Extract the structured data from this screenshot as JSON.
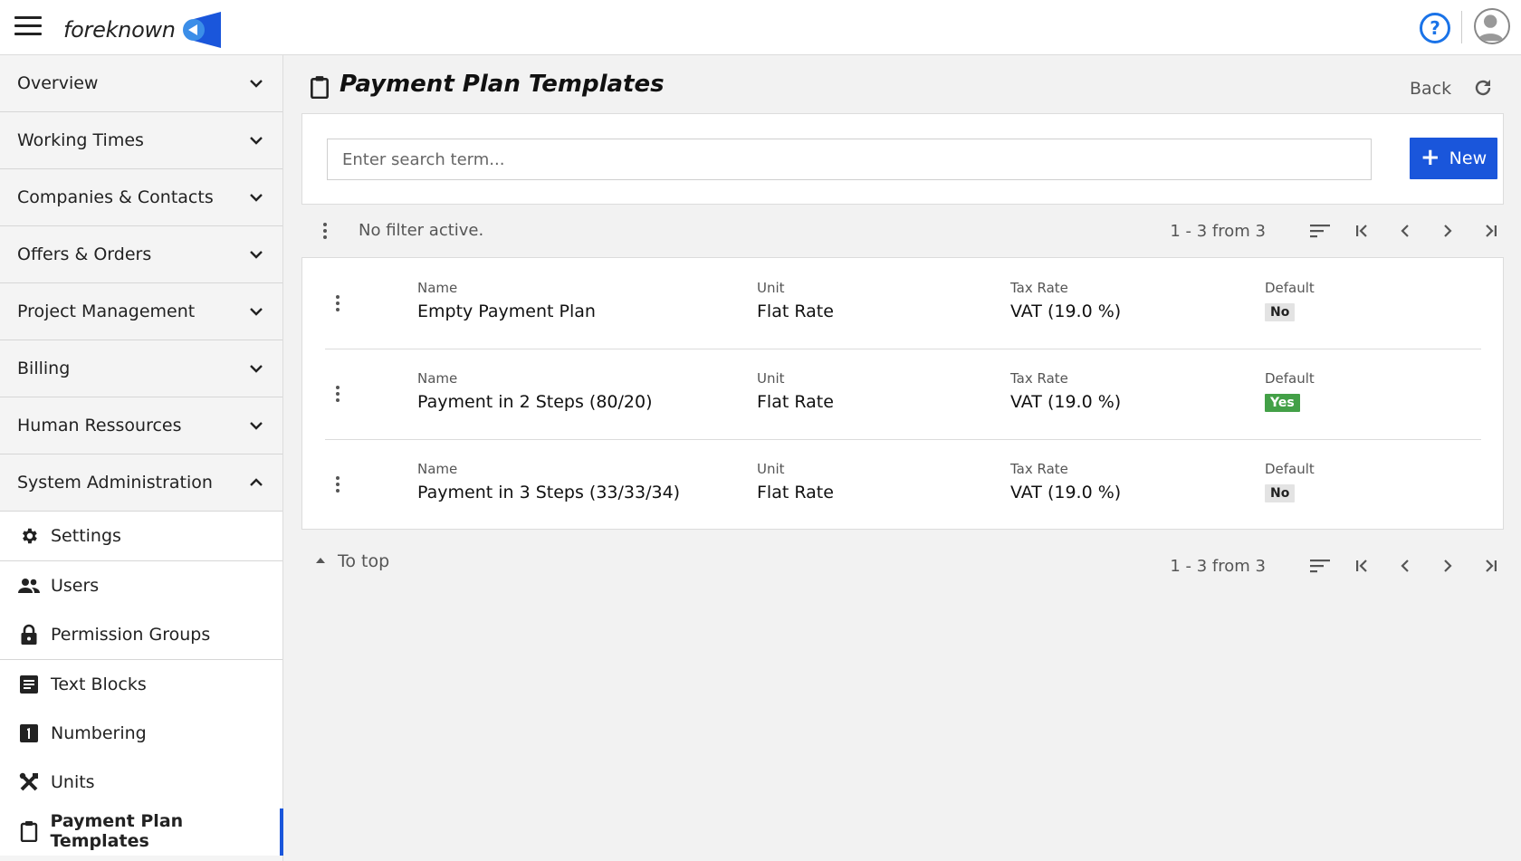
{
  "header": {
    "brand_name": "foreknown",
    "help_symbol": "?",
    "menu_icon": "hamburger-icon",
    "avatar_icon": "user-avatar-icon"
  },
  "sidebar": {
    "sections": [
      {
        "label": "Overview",
        "expanded": false
      },
      {
        "label": "Working Times",
        "expanded": false
      },
      {
        "label": "Companies & Contacts",
        "expanded": false
      },
      {
        "label": "Offers & Orders",
        "expanded": false
      },
      {
        "label": "Project Management",
        "expanded": false
      },
      {
        "label": "Billing",
        "expanded": false
      },
      {
        "label": "Human Ressources",
        "expanded": false
      },
      {
        "label": "System Administration",
        "expanded": true
      }
    ],
    "subitems": [
      {
        "label": "Settings",
        "icon": "gear-icon"
      },
      {
        "label": "Users",
        "icon": "users-icon"
      },
      {
        "label": "Permission Groups",
        "icon": "lock-icon"
      },
      {
        "label": "Text Blocks",
        "icon": "text-block-icon"
      },
      {
        "label": "Numbering",
        "icon": "numbering-icon"
      },
      {
        "label": "Units",
        "icon": "tools-icon"
      },
      {
        "label": "Payment Plan Templates",
        "icon": "clipboard-icon",
        "active": true
      }
    ]
  },
  "page": {
    "title": "Payment Plan Templates",
    "back_label": "Back"
  },
  "search": {
    "placeholder": "Enter search term...",
    "value": "",
    "new_label": "New"
  },
  "toolbar": {
    "filter_text": "No filter active.",
    "count_text": "1 - 3 from 3"
  },
  "table": {
    "columns": {
      "name": "Name",
      "unit": "Unit",
      "tax_rate": "Tax Rate",
      "default": "Default"
    },
    "rows": [
      {
        "name": "Empty Payment Plan",
        "unit": "Flat Rate",
        "tax_rate": "VAT (19.0 %)",
        "default": "No"
      },
      {
        "name": "Payment in 2 Steps (80/20)",
        "unit": "Flat Rate",
        "tax_rate": "VAT (19.0 %)",
        "default": "Yes"
      },
      {
        "name": "Payment in 3 Steps (33/33/34)",
        "unit": "Flat Rate",
        "tax_rate": "VAT (19.0 %)",
        "default": "No"
      }
    ]
  },
  "footer": {
    "to_top_label": "To top",
    "count_text": "1 - 3 from 3"
  },
  "colors": {
    "accent": "#1a56db",
    "brand_blue": "#1a73e8",
    "badge_yes": "#43a047",
    "badge_no": "#e3e3e3"
  }
}
